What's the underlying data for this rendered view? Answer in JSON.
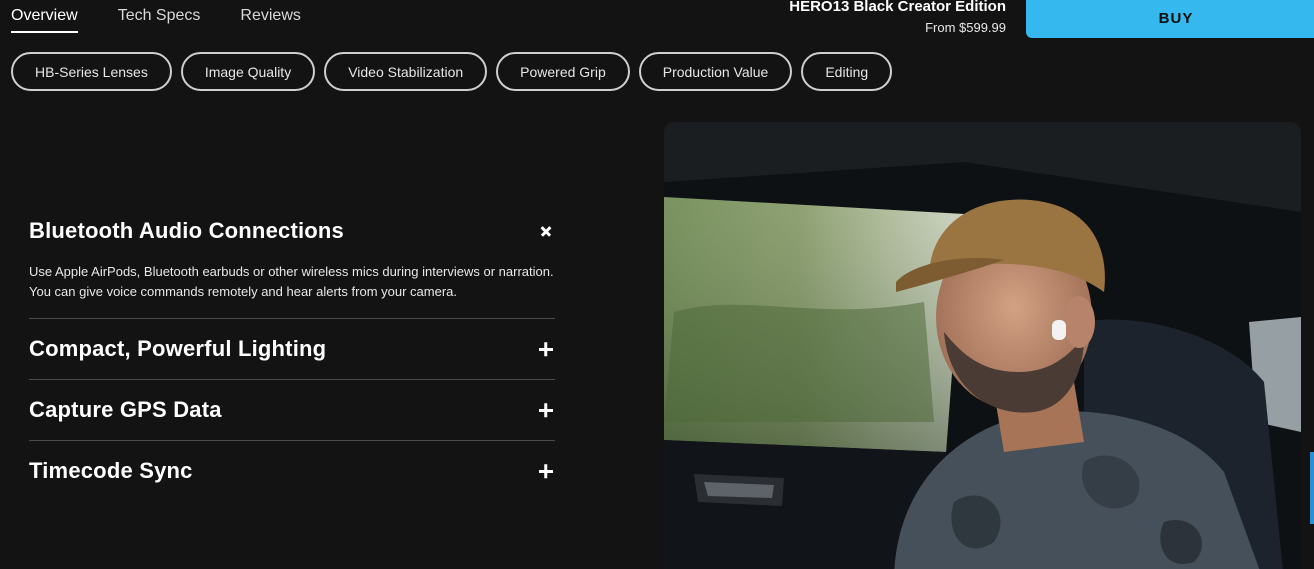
{
  "nav": {
    "tabs": [
      {
        "label": "Overview",
        "active": true
      },
      {
        "label": "Tech Specs",
        "active": false
      },
      {
        "label": "Reviews",
        "active": false
      }
    ]
  },
  "product": {
    "name": "HERO13 Black Creator Edition",
    "price": "From $599.99",
    "buy_label": "BUY"
  },
  "pills": [
    "HB-Series Lenses",
    "Image Quality",
    "Video Stabilization",
    "Powered Grip",
    "Production Value",
    "Editing"
  ],
  "accordion": [
    {
      "title": "Bluetooth Audio Connections",
      "open": true,
      "body": "Use Apple AirPods, Bluetooth earbuds or other wireless mics during interviews or narration. You can give voice commands remotely and hear alerts from your camera."
    },
    {
      "title": "Compact, Powerful Lighting",
      "open": false
    },
    {
      "title": "Capture GPS Data",
      "open": false
    },
    {
      "title": "Timecode Sync",
      "open": false
    }
  ],
  "colors": {
    "background": "#131313",
    "accent": "#35b8ee"
  },
  "icons": {
    "close": "close-icon",
    "expand": "plus-icon"
  }
}
